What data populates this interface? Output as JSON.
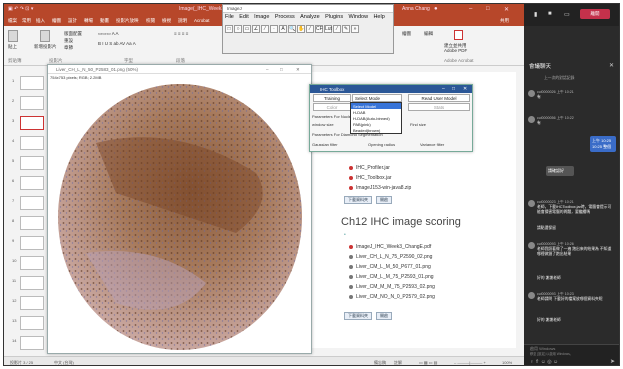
{
  "ppt": {
    "title": "Image(_IHC_Week3_ChangE.pptx - PowerPoint",
    "account": "Anna Chang",
    "tabs": [
      "檔案",
      "常用",
      "插入",
      "繪圖",
      "設計",
      "轉場",
      "動畫",
      "投影片放映",
      "校閱",
      "檢視",
      "說明",
      "Acrobat"
    ],
    "share": "共用",
    "ribbon_groups": [
      "貼上",
      "剪貼簿",
      "新增投影片",
      "版面配置",
      "重設",
      "章節",
      "投影片",
      "字型",
      "段落",
      "繪圖",
      "編輯",
      "建立並共用 Adobe PDF",
      "Adobe Acrobat"
    ],
    "thumbnail_numbers": [
      "1",
      "2",
      "3",
      "4",
      "5",
      "6",
      "7",
      "8",
      "9",
      "10",
      "11",
      "12",
      "13",
      "14",
      "15",
      "16",
      "17",
      "18",
      "19"
    ],
    "status": {
      "slide": "投影片 3 / 25",
      "lang": "中文 (台灣)",
      "notes": "備忘稿",
      "comments": "註解",
      "zoom": "100%"
    }
  },
  "imagej": {
    "title": "ImageJ",
    "menu": [
      "File",
      "Edit",
      "Image",
      "Process",
      "Analyze",
      "Plugins",
      "Window",
      "Help"
    ],
    "tools": [
      "□",
      "○",
      "▭",
      "∠",
      "⁄",
      "·",
      "A",
      "🔍",
      "✋",
      "⁄",
      "CF",
      "Lut",
      "⁄",
      "✎",
      "»"
    ]
  },
  "image_window": {
    "title": "Liver_CH_L_N_50_P2583_01.png (50%)",
    "subtitle": "754x753 pixels; RGB; 2.2MB"
  },
  "ihc_toolbox": {
    "title": "IHC Toolbox",
    "training": "Training",
    "select_mode": "Select Mode",
    "read_user": "Read User Model",
    "color": "Color",
    "stats": "Stats",
    "nucleus_label": "Parameters For Nuclei Segmentation",
    "window_size": "window size",
    "find_size": "Find size",
    "diamond_label": "Parameters For Diamond Segmentation",
    "gaussian": "Gaussian filter",
    "opening": "Opening radius",
    "variance": "Variance filter",
    "dropdown": [
      "Select Model",
      "H-DAB",
      "H-DAB(Auto-binned)",
      "PAB(pink)",
      "Beaded(brown)"
    ]
  },
  "slide": {
    "files_top": [
      "IHC_Profiler.jar",
      "IHC_Toolbox.jar",
      "ImageJ153-win-java8.zip"
    ],
    "btn_download": "下載資料夾",
    "btn_open": "開啟",
    "heading": "Ch12 IHC image scoring",
    "files_bottom": [
      "ImageJ_IHC_Week3_ChangE.pdf",
      "Liver_CH_L_N_75_P2590_02.png",
      "Liver_CM_L_M_50_P677_01.png",
      "Liver_CM_L_M_75_P2593_01.png",
      "Liver_CM_M_M_75_P2593_02.png",
      "Liver_CM_NO_N_0_P2579_02.png"
    ]
  },
  "chat": {
    "title": "會議聊天",
    "subtitle": "上一次的對話記錄",
    "messages": [
      {
        "name": "cul0000026 上午 10:21",
        "text": "有"
      },
      {
        "name": "cul0000056 上午 10:22",
        "text": "有"
      },
      {
        "name": "cul0000023 上午 10:21",
        "text": "老師，下載IHCToolbox.jar時，電腦會提示可能會損害電腦的問題，要繼續嗎"
      },
      {
        "name": "cul0000082 上午 10:21",
        "text": "請點選保留"
      },
      {
        "name": "cul0000093 上午 10:26",
        "text": "老師我照著做了一遍 跑出來的結果為 不知道哪裡做錯了跑出結果"
      },
      {
        "name": "cul0000093 上午 10:26",
        "text": "好的 謝謝老師"
      },
      {
        "name": "cul0000093 上午 10:23",
        "text": "老師請問 下載好的檔案放哪個資料夾呢"
      },
      {
        "name": "cul0000093 上午 10:26",
        "text": "好的 謝謝老師"
      }
    ],
    "self_msg": "上午 10:25 10:25 整個",
    "self_msg2": "請確認好",
    "input_hint": "啟用 Windows",
    "input_hint2": "移至 [設定] 以啟用 Windows。",
    "leave": "離開"
  }
}
